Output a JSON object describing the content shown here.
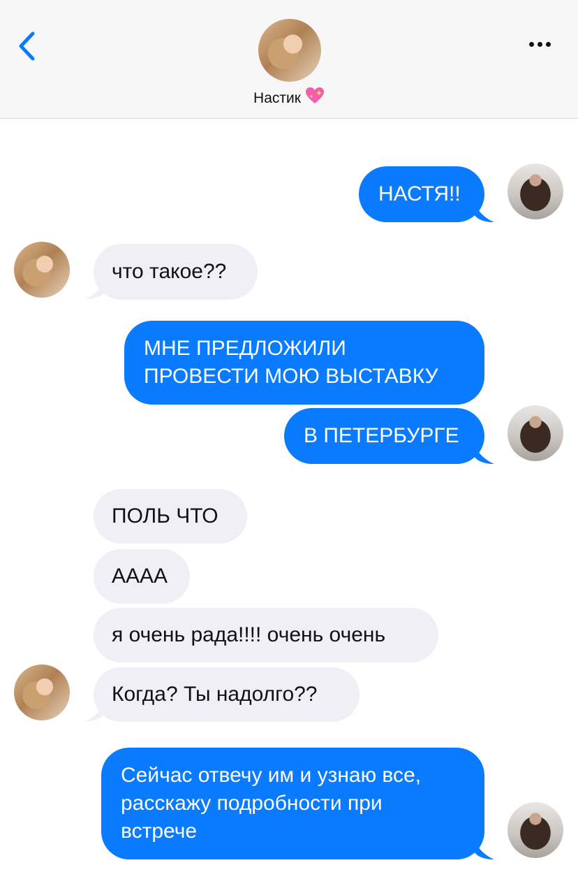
{
  "header": {
    "contact_name": "Настик",
    "heart_icon": "sparkling-heart-icon",
    "back_icon": "chevron-left-icon",
    "more_icon": "ellipsis-icon",
    "accent_color": "#0a7aff"
  },
  "messages": [
    {
      "sender": "me",
      "text": "НАСТЯ!!"
    },
    {
      "sender": "contact",
      "text": "что такое??"
    },
    {
      "sender": "me",
      "lines": [
        "МНЕ ПРЕДЛОЖИЛИ",
        "ПРОВЕСТИ МОЮ ВЫСТАВКУ"
      ]
    },
    {
      "sender": "me",
      "text": "В ПЕТЕРБУРГЕ"
    },
    {
      "sender": "contact",
      "text": "ПОЛЬ ЧТО"
    },
    {
      "sender": "contact",
      "text": "АААА"
    },
    {
      "sender": "contact",
      "text": "я очень рада!!!! очень очень"
    },
    {
      "sender": "contact",
      "text": "Когда? Ты надолго??"
    },
    {
      "sender": "me",
      "lines": [
        "Сейчас отвечу им и узнаю все,",
        "расскажу подробности при",
        "встрече"
      ]
    }
  ],
  "colors": {
    "outgoing_bubble": "#0a7aff",
    "incoming_bubble": "#f0eff5"
  }
}
